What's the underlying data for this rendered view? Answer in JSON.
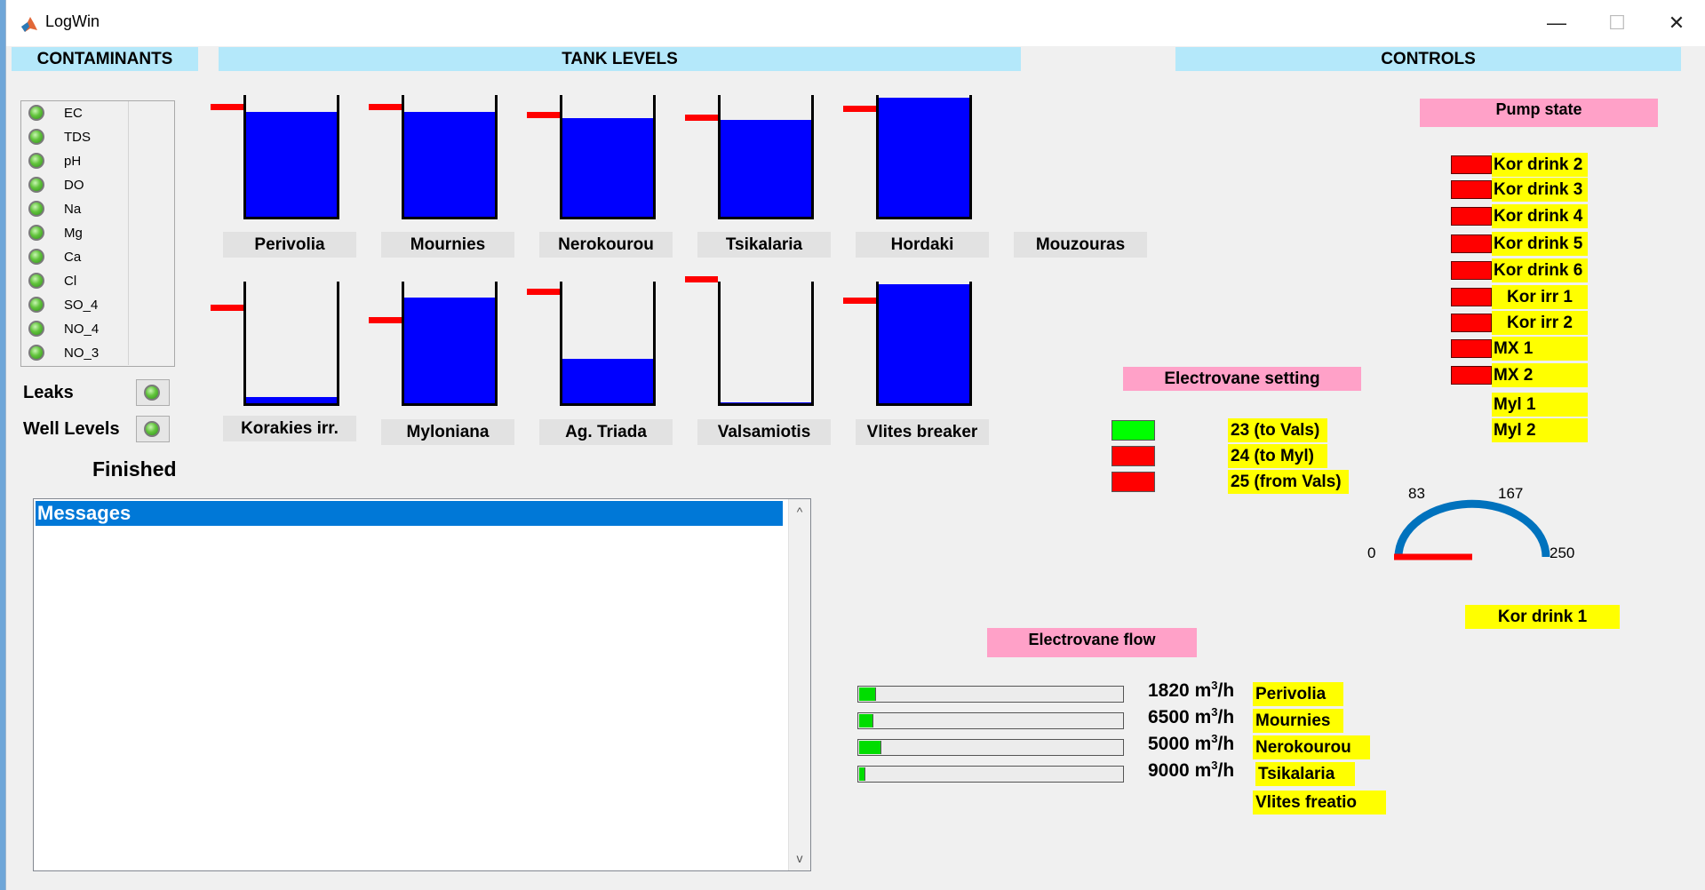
{
  "window": {
    "title": "LogWin",
    "minimize": "—",
    "maximize": "☐",
    "close": "✕"
  },
  "headers": {
    "contaminants": "CONTAMINANTS",
    "tank_levels": "TANK LEVELS",
    "controls": "CONTROLS"
  },
  "contaminants": [
    "EC",
    "TDS",
    "pH",
    "DO",
    "Na",
    "Mg",
    "Ca",
    "Cl",
    "SO_4",
    "NO_4",
    "NO_3"
  ],
  "indicators": {
    "leaks": "Leaks",
    "well_levels": "Well Levels"
  },
  "status": "Finished",
  "messages": {
    "header": "Messages",
    "scroll_up": "^",
    "scroll_down": "v"
  },
  "tanks": [
    {
      "name": "Perivolia",
      "level": 0.88,
      "setpoint": 0.91
    },
    {
      "name": "Mournies",
      "level": 0.88,
      "setpoint": 0.91
    },
    {
      "name": "Nerokourou",
      "level": 0.83,
      "setpoint": 0.84
    },
    {
      "name": "Tsikalaria",
      "level": 0.81,
      "setpoint": 0.82
    },
    {
      "name": "Hordaki",
      "level": 1.0,
      "setpoint": 0.89
    },
    {
      "name": "Mouzouras",
      "level": null,
      "setpoint": null
    },
    {
      "name": "Korakies irr.",
      "level": 0.05,
      "setpoint": 0.79
    },
    {
      "name": "Myloniana",
      "level": 0.89,
      "setpoint": 0.69
    },
    {
      "name": "Ag. Triada",
      "level": 0.37,
      "setpoint": 0.92
    },
    {
      "name": "Valsamiotis",
      "level": 0.01,
      "setpoint": 1.02
    },
    {
      "name": "Vlites breaker",
      "level": 1.0,
      "setpoint": 0.85
    }
  ],
  "pump_state": {
    "title": "Pump state",
    "pumps": [
      {
        "label": "Kor drink 2",
        "switch": true
      },
      {
        "label": "Kor drink 3",
        "switch": true
      },
      {
        "label": "Kor drink 4",
        "switch": true
      },
      {
        "label": "Kor drink 5",
        "switch": true
      },
      {
        "label": "Kor drink 6",
        "switch": true
      },
      {
        "label": "Kor irr 1",
        "switch": true
      },
      {
        "label": "Kor irr 2",
        "switch": true
      },
      {
        "label": "MX 1",
        "switch": true
      },
      {
        "label": "MX 2",
        "switch": true
      },
      {
        "label": "Myl 1",
        "switch": false
      },
      {
        "label": "Myl 2",
        "switch": false
      }
    ]
  },
  "electrovane_setting": {
    "title": "Electrovane setting",
    "items": [
      {
        "label": "23 (to Vals)",
        "color": "#00ff00"
      },
      {
        "label": "24 (to Myl)",
        "color": "#ff0000"
      },
      {
        "label": "25 (from Vals)",
        "color": "#ff0000"
      }
    ]
  },
  "gauge": {
    "ticks": [
      "0",
      "83",
      "167",
      "250"
    ],
    "min": 0,
    "max": 250,
    "value": 0,
    "label": "Kor drink 1",
    "arc_color": "#0072bd",
    "needle_color": "#ff0000"
  },
  "electrovane_flow": {
    "title": "Electrovane flow",
    "unit_prefix": "m",
    "unit_exp": "3",
    "unit_suffix": "/h",
    "rows": [
      {
        "value": "1820",
        "name": "Perivolia",
        "fill": 0.06
      },
      {
        "value": "6500",
        "name": "Mournies",
        "fill": 0.05
      },
      {
        "value": "5000",
        "name": "Nerokourou",
        "fill": 0.08
      },
      {
        "value": "9000",
        "name": "Tsikalaria",
        "fill": 0.02
      }
    ],
    "extra_label": "Vlites freatio"
  }
}
